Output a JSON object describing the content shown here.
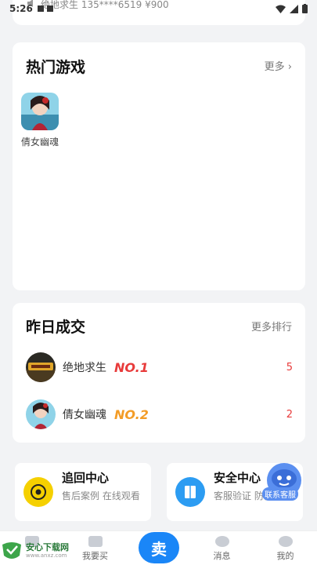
{
  "status_bar": {
    "time": "5:26"
  },
  "ticker": {
    "text": "绝地求生 135****6519 ¥900"
  },
  "hot_games": {
    "title": "热门游戏",
    "more": "更多",
    "items": [
      {
        "name": "倩女幽魂"
      }
    ]
  },
  "deals": {
    "title": "昨日成交",
    "more": "更多排行",
    "rows": [
      {
        "name": "绝地求生",
        "rank": "NO.1",
        "count": "5",
        "rank_color": "#e83b3b"
      },
      {
        "name": "倩女幽魂",
        "rank": "NO.2",
        "count": "2",
        "rank_color": "#f39c26"
      }
    ]
  },
  "services": [
    {
      "title": "追回中心",
      "desc": "售后案例 在线观看",
      "icon": "target-icon",
      "color": "#f5d000"
    },
    {
      "title": "安全中心",
      "desc": "客服验证 防骗技巧",
      "icon": "book-icon",
      "color": "#2c9cf2"
    }
  ],
  "float_button": {
    "label": "联系客服"
  },
  "tabbar": {
    "items": [
      {
        "label": "我要买"
      },
      {
        "label": "卖"
      },
      {
        "label": "消息"
      },
      {
        "label": "我的"
      }
    ]
  },
  "watermark": {
    "title": "安心下载网",
    "url": "www.anxz.com"
  }
}
